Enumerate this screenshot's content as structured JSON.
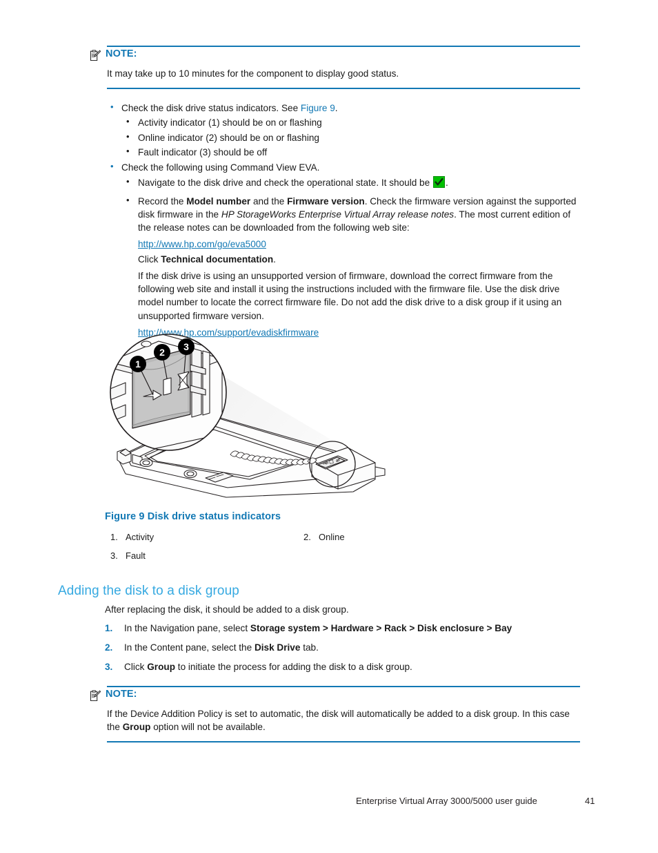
{
  "note_top": {
    "icon": "note-clipboard-icon",
    "title": "NOTE:",
    "body": "It may take up to 10 minutes for the component to display good status."
  },
  "bullets": {
    "item1_pre": "Check the disk drive status indicators.  See ",
    "item1_xref": "Figure 9",
    "item1_post": ".",
    "sub1": "Activity indicator (1) should be on or flashing",
    "sub2": "Online indicator (2) should be on or flashing",
    "sub3": "Fault indicator (3) should be off",
    "item2": "Check the following using Command View EVA.",
    "sub4_pre": "Navigate to the disk drive and check the operational state.  It should be ",
    "sub4_post": ".",
    "sub5_a": "Record the ",
    "sub5_b_bold": "Model number",
    "sub5_c": " and the ",
    "sub5_d_bold": "Firmware version",
    "sub5_e": ".  Check the firmware version against the supported disk firmware in the ",
    "sub5_f_italic": "HP StorageWorks Enterprise Virtual Array release notes",
    "sub5_g": ".  The most current edition of the release notes can be downloaded from the following web site:",
    "link1": "http://www.hp.com/go/eva5000",
    "click_pre": "Click ",
    "click_bold": "Technical documentation",
    "click_post": ".",
    "para": "If the disk drive is using an unsupported version of firmware, download the correct firmware from the following web site and install it using the instructions included with the firmware file.  Use the disk drive model number to locate the correct firmware file.  Do not add the disk drive to a disk group if it using an unsupported firmware version.",
    "link2": "http://www.hp.com/support/evadiskfirmware"
  },
  "figure": {
    "image_name": "disk-drive-status-indicators-illustration",
    "callouts": [
      "1",
      "2",
      "3"
    ],
    "caption_label": "Figure 9",
    "caption_title": "Disk drive status indicators",
    "legend": [
      {
        "num": "1.",
        "label": "Activity"
      },
      {
        "num": "2.",
        "label": "Online"
      },
      {
        "num": "3.",
        "label": "Fault"
      }
    ]
  },
  "section": {
    "heading": "Adding the disk to a disk group",
    "intro": "After replacing the disk, it should be added to a disk group.",
    "steps": [
      {
        "num": "1.",
        "pre": "In the Navigation pane, select ",
        "bold": "Storage system > Hardware > Rack > Disk enclosure > Bay",
        "post": ""
      },
      {
        "num": "2.",
        "pre": "In the Content pane, select the ",
        "bold": "Disk Drive",
        "post": " tab."
      },
      {
        "num": "3.",
        "pre": "Click ",
        "bold": "Group",
        "post": " to initiate the process for adding the disk to a disk group."
      }
    ]
  },
  "note_bottom": {
    "icon": "note-clipboard-icon",
    "title": "NOTE:",
    "body_a": "If the Device Addition Policy is set to automatic, the disk will automatically be added to a disk group.  In this case the ",
    "body_bold": "Group",
    "body_b": " option will not be available."
  },
  "footer": {
    "guide_title": "Enterprise Virtual Array 3000/5000 user guide",
    "page_number": "41"
  },
  "colors": {
    "accent_blue": "#1278b4",
    "heading_blue": "#36a9e1",
    "ok_green": "#00c000"
  }
}
